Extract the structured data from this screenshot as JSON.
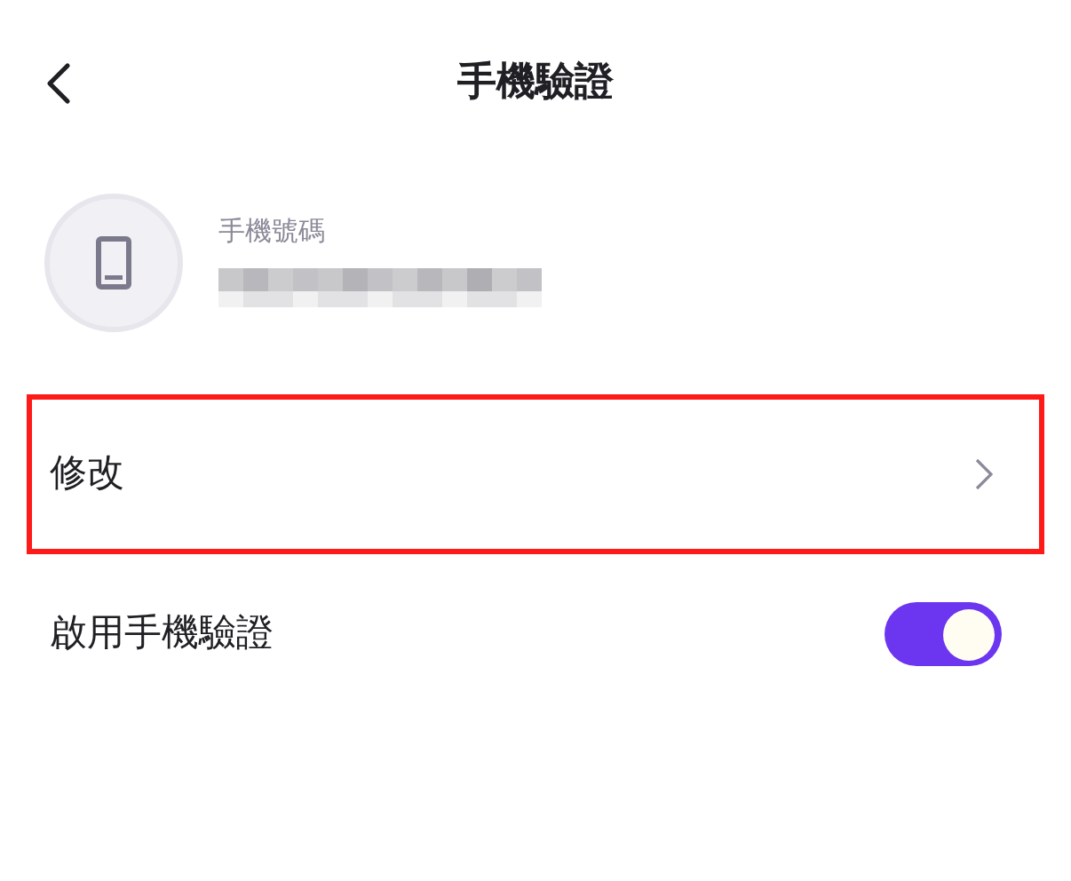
{
  "header": {
    "title": "手機驗證"
  },
  "phone": {
    "label": "手機號碼"
  },
  "rows": [
    {
      "kind": "link",
      "label": "修改",
      "highlighted": true
    },
    {
      "kind": "toggle",
      "label": "啟用手機驗證",
      "on": true
    }
  ]
}
